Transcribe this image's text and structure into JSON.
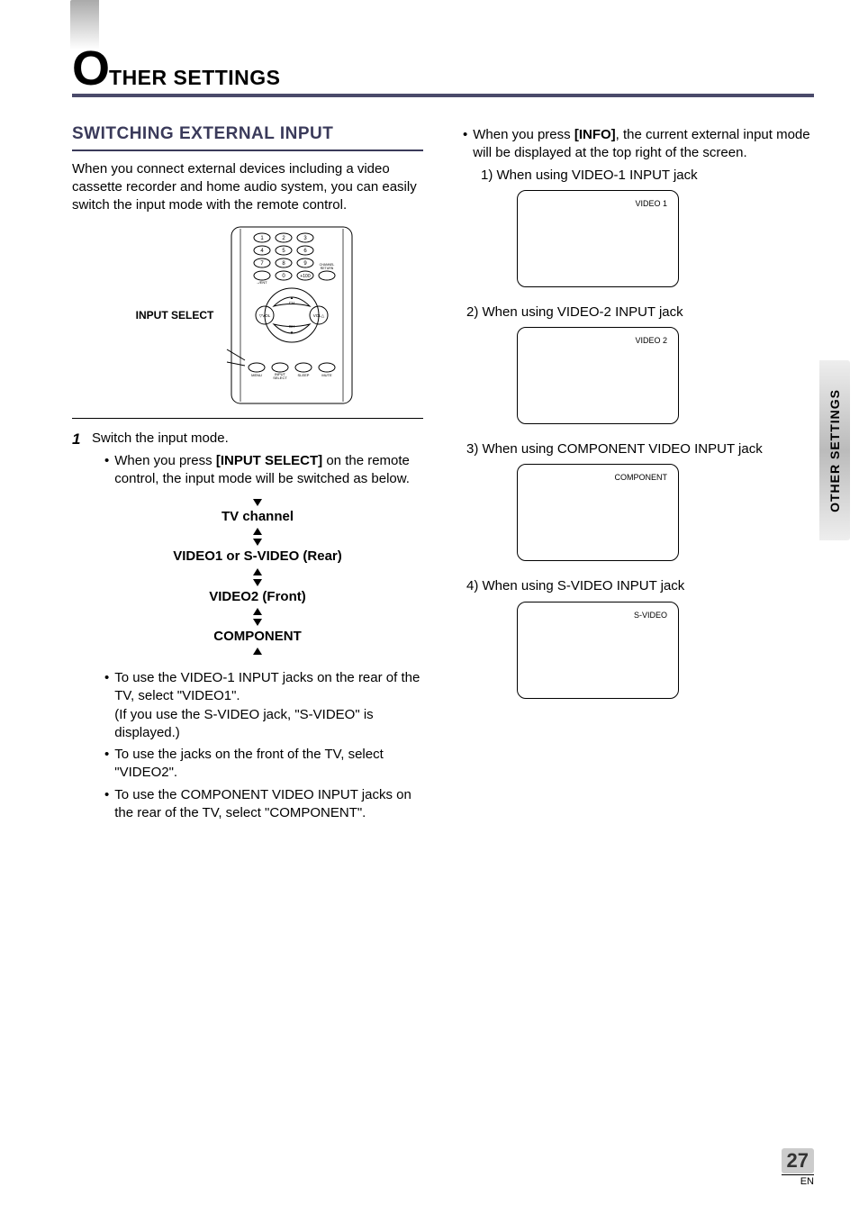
{
  "chapter": {
    "big_o": "O",
    "rest": "THER SETTINGS"
  },
  "section": {
    "title": "SWITCHING EXTERNAL INPUT",
    "intro": "When you connect external devices including a video cassette recorder and home audio system, you can easily switch the input mode with the remote control."
  },
  "remote": {
    "label": "INPUT SELECT",
    "keys": [
      "1",
      "2",
      "3",
      "4",
      "5",
      "6",
      "7",
      "8",
      "9",
      "0",
      "+100"
    ],
    "ent_label": "–/ENT",
    "ch_return": "CHANNEL RETURN",
    "vol_minus": "VOL",
    "vol_plus": "VOL",
    "ch_up": "CH",
    "ch_down": "CH",
    "menu": "MENU",
    "input_select": "INPUT SELECT",
    "sleep": "SLEEP",
    "mute": "MUTE"
  },
  "step1": {
    "num": "1",
    "text": "Switch the input mode.",
    "bullet1_pre": "When you press ",
    "bullet1_bold": "[INPUT SELECT]",
    "bullet1_post": " on the remote control, the input mode will be switched as below."
  },
  "mode_diagram": {
    "line1": "TV channel",
    "line2": "VIDEO1 or S-VIDEO (Rear)",
    "line3": "VIDEO2 (Front)",
    "line4": "COMPONENT"
  },
  "bullets_left": {
    "b2a": "To use the VIDEO-1 INPUT jacks on the rear of the TV, select \"VIDEO1\".",
    "b2b": "(If you use the S-VIDEO jack, \"S-VIDEO\" is displayed.)",
    "b3": "To use the jacks on the front of the TV, select \"VIDEO2\".",
    "b4": "To use the COMPONENT VIDEO INPUT jacks on the rear of the TV, select \"COMPONENT\"."
  },
  "right": {
    "bullet_pre": "When you press ",
    "bullet_bold": "[INFO]",
    "bullet_post": ", the current external input mode will be displayed at the top right of the screen.",
    "items": [
      {
        "label": "1) When using VIDEO-1 INPUT jack",
        "tag": "VIDEO 1"
      },
      {
        "label": "2) When using VIDEO-2 INPUT jack",
        "tag": "VIDEO 2"
      },
      {
        "label": "3) When using COMPONENT VIDEO INPUT jack",
        "tag": "COMPONENT"
      },
      {
        "label": "4) When using S-VIDEO INPUT jack",
        "tag": "S-VIDEO"
      }
    ]
  },
  "side_tab": "OTHER SETTINGS",
  "footer": {
    "page": "27",
    "en": "EN"
  }
}
